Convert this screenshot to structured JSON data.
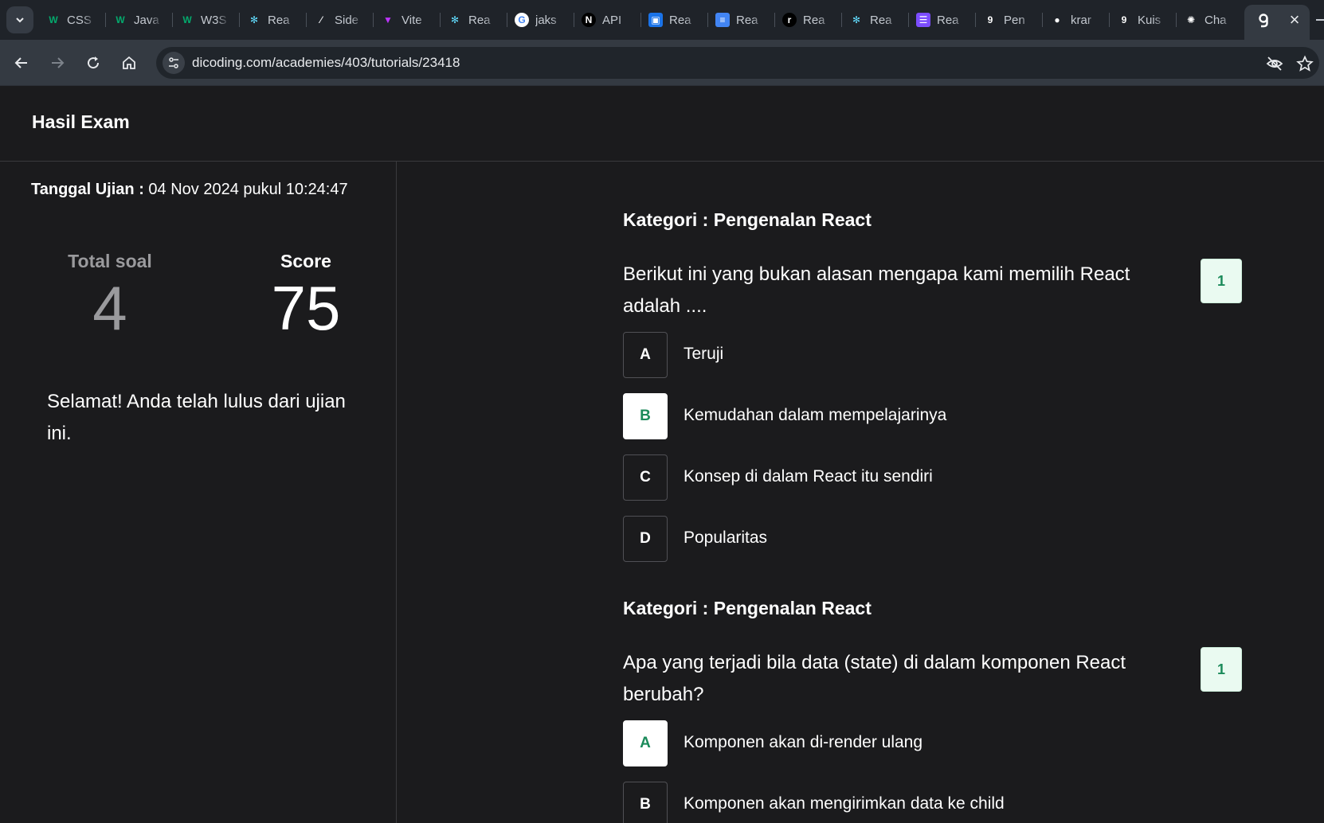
{
  "browser": {
    "tabs": [
      {
        "label": "CSS",
        "icon": "w3schools-icon",
        "color": "#04aa6d"
      },
      {
        "label": "Java",
        "icon": "w3schools-icon",
        "color": "#04aa6d"
      },
      {
        "label": "W3S",
        "icon": "w3schools-icon",
        "color": "#04aa6d"
      },
      {
        "label": "Rea",
        "icon": "react-icon",
        "color": "#61dafb"
      },
      {
        "label": "Side",
        "icon": "slash-icon",
        "color": "#e8eaed"
      },
      {
        "label": "Vite",
        "icon": "vite-icon",
        "color": "#bd34fe"
      },
      {
        "label": "Rea",
        "icon": "react-icon",
        "color": "#61dafb"
      },
      {
        "label": "jaks",
        "icon": "google-icon",
        "color": "#ffffff"
      },
      {
        "label": "API",
        "icon": "n-icon",
        "color": "#000000"
      },
      {
        "label": "Rea",
        "icon": "image-icon",
        "color": "#1a73e8"
      },
      {
        "label": "Rea",
        "icon": "docs-icon",
        "color": "#4285f4"
      },
      {
        "label": "Rea",
        "icon": "r-icon",
        "color": "#000000"
      },
      {
        "label": "Rea",
        "icon": "react-icon",
        "color": "#61dafb"
      },
      {
        "label": "Rea",
        "icon": "list-icon",
        "color": "#7c4dff"
      },
      {
        "label": "Pen",
        "icon": "dicoding-icon",
        "color": "#ffffff"
      },
      {
        "label": "krar",
        "icon": "github-icon",
        "color": "#ffffff"
      },
      {
        "label": "Kuis",
        "icon": "dicoding-icon",
        "color": "#ffffff"
      },
      {
        "label": "Cha",
        "icon": "chatgpt-icon",
        "color": "#ffffff"
      }
    ],
    "active_tab_close": "×",
    "url": "dicoding.com/academies/403/tutorials/23418"
  },
  "page": {
    "title": "Hasil Exam",
    "exam_date_label": "Tanggal Ujian :",
    "exam_date_value": " 04 Nov 2024 pukul 10:24:47",
    "total_label": "Total soal",
    "total_value": "4",
    "score_label": "Score",
    "score_value": "75",
    "pass_message": "Selamat! Anda telah lulus dari ujian ini."
  },
  "questions": [
    {
      "category": "Kategori : Pengenalan React",
      "text": "Berikut ini yang bukan alasan mengapa kami memilih React adalah ....",
      "score": "1",
      "options": [
        {
          "letter": "A",
          "text": "Teruji"
        },
        {
          "letter": "B",
          "text": "Kemudahan dalam mempelajarinya"
        },
        {
          "letter": "C",
          "text": "Konsep di dalam React itu sendiri"
        },
        {
          "letter": "D",
          "text": "Popularitas"
        }
      ],
      "selected": "B"
    },
    {
      "category": "Kategori : Pengenalan React",
      "text": "Apa yang terjadi bila data (state) di dalam komponen React berubah?",
      "score": "1",
      "options": [
        {
          "letter": "A",
          "text": "Komponen akan di-render ulang"
        },
        {
          "letter": "B",
          "text": "Komponen akan mengirimkan data ke child"
        }
      ],
      "selected": "A"
    }
  ],
  "colors": {
    "accent_green": "#1b8a5a",
    "page_bg": "#1b1b1d",
    "chrome_bg": "#343a42"
  }
}
